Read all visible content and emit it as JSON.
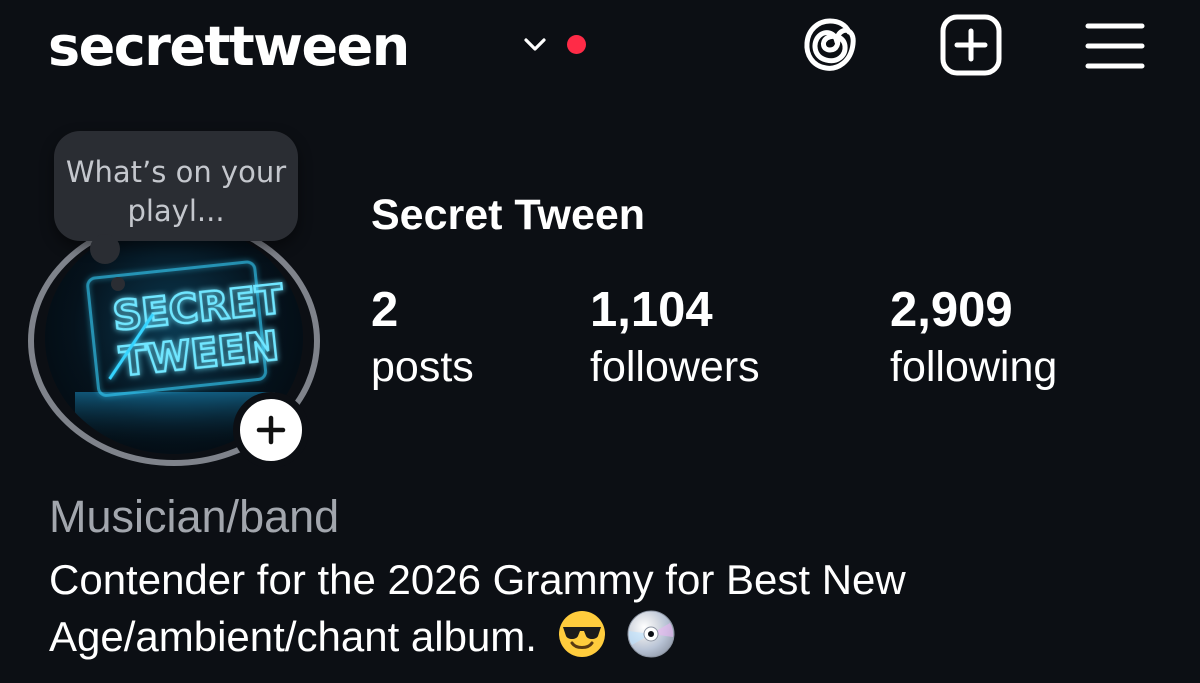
{
  "header": {
    "username": "secrettween",
    "switch_account_icon": "chevron-down-icon",
    "notification_color": "#ff2b47",
    "icons": [
      "threads-icon",
      "create-plus-icon",
      "hamburger-menu-icon"
    ]
  },
  "note": {
    "text": "What’s on your playl..."
  },
  "avatar": {
    "logo_text_line1": "SECRET",
    "logo_text_line2": "TWEEN",
    "add_story_icon": "plus-icon"
  },
  "profile": {
    "display_name": "Secret Tween",
    "stats": [
      {
        "value": "2",
        "label": "posts"
      },
      {
        "value": "1,104",
        "label": "followers"
      },
      {
        "value": "2,909",
        "label": "following"
      }
    ],
    "category": "Musician/band",
    "bio": "Contender for the 2026 Grammy for Best New Age/ambient/chant album.",
    "bio_emojis": [
      "smiling-face-with-sunglasses-icon",
      "optical-disc-icon"
    ]
  },
  "colors": {
    "background": "#0c0f14",
    "text": "#ffffff",
    "secondary_text": "#a2a6ad",
    "neon": "#35d4ff"
  }
}
